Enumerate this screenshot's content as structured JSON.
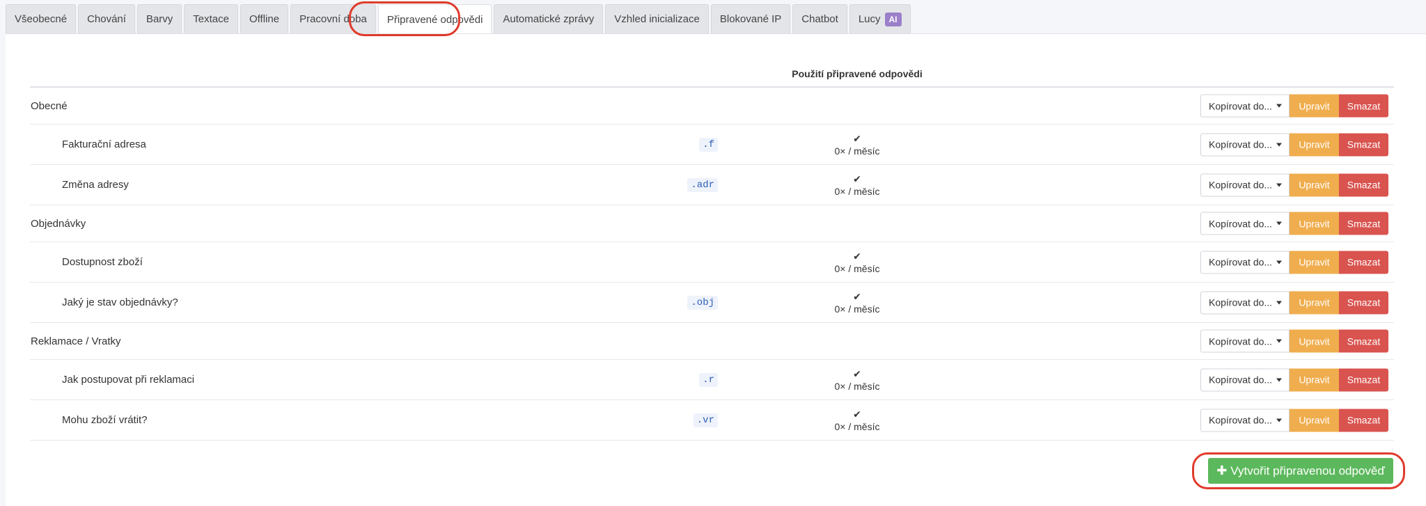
{
  "tabs": [
    {
      "label": "Všeobecné"
    },
    {
      "label": "Chování"
    },
    {
      "label": "Barvy"
    },
    {
      "label": "Textace"
    },
    {
      "label": "Offline"
    },
    {
      "label": "Pracovní doba"
    },
    {
      "label": "Připravené odpovědi",
      "active": true
    },
    {
      "label": "Automatické zprávy"
    },
    {
      "label": "Vzhled inicializace"
    },
    {
      "label": "Blokované IP"
    },
    {
      "label": "Chatbot"
    },
    {
      "label": "Lucy",
      "badge": "AI"
    }
  ],
  "table": {
    "usage_header": "Použití připravené odpovědi",
    "rows": [
      {
        "kind": "category",
        "name": "Obecné"
      },
      {
        "kind": "item",
        "name": "Fakturační adresa",
        "shortcut": ".f",
        "usage": "0× / měsíc"
      },
      {
        "kind": "item",
        "name": "Změna adresy",
        "shortcut": ".adr",
        "usage": "0× / měsíc"
      },
      {
        "kind": "category",
        "name": "Objednávky"
      },
      {
        "kind": "item",
        "name": "Dostupnost zboží",
        "shortcut": "",
        "usage": "0× / měsíc"
      },
      {
        "kind": "item",
        "name": "Jaký je stav objednávky?",
        "shortcut": ".obj",
        "usage": "0× / měsíc"
      },
      {
        "kind": "category",
        "name": "Reklamace / Vratky"
      },
      {
        "kind": "item",
        "name": "Jak postupovat při reklamaci",
        "shortcut": ".r",
        "usage": "0× / měsíc"
      },
      {
        "kind": "item",
        "name": "Mohu zboží vrátit?",
        "shortcut": ".vr",
        "usage": "0× / měsíc"
      }
    ]
  },
  "actions": {
    "copy_label": "Kopírovat do...",
    "edit_label": "Upravit",
    "delete_label": "Smazat"
  },
  "create_button": {
    "label": "Vytvořit připravenou odpověď"
  },
  "icons": {
    "check": "check-icon",
    "plus": "plus-icon",
    "caret": "caret-down-icon"
  },
  "colors": {
    "edit": "#f0ad4e",
    "delete": "#d9534f",
    "create": "#5cb85c",
    "highlight": "#e03a2b",
    "ai_badge": "#9b7fc9"
  }
}
